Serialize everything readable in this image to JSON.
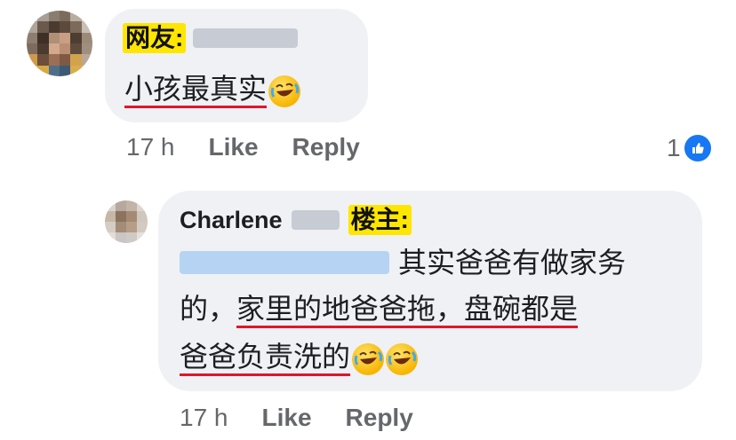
{
  "comment1": {
    "tag": "网友:",
    "text": "小孩最真实",
    "time": "17 h",
    "like": "Like",
    "reply": "Reply",
    "reaction_count": "1"
  },
  "comment2": {
    "author": "Charlene",
    "tag": "楼主:",
    "line1": "其实爸爸有做家务",
    "line2_plain": "的，",
    "line2_underlined": "家里的地爸爸拖，盘碗都是",
    "line3_underlined": "爸爸负责洗的",
    "time": "17 h",
    "like": "Like",
    "reply": "Reply"
  },
  "colors": {
    "bubble": "#eff1f5",
    "tag_bg": "#ffe600",
    "underline": "#e0162a",
    "meta": "#65676b",
    "fb_blue": "#1877f2"
  },
  "icons": [
    "rofl-emoji-icon",
    "like-reaction-icon",
    "avatar"
  ]
}
